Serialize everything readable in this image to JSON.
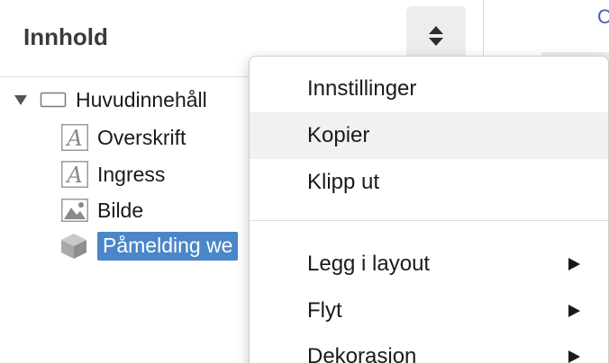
{
  "panel": {
    "title": "Innhold"
  },
  "tree": {
    "root": {
      "label": "Huvudinnehåll"
    },
    "children": [
      {
        "label": "Overskrift",
        "icon": "text-a-icon"
      },
      {
        "label": "Ingress",
        "icon": "text-a-icon"
      },
      {
        "label": "Bilde",
        "icon": "image-icon"
      },
      {
        "label": "Påmelding we",
        "icon": "cube-icon",
        "selected": true
      }
    ]
  },
  "context_menu": {
    "items": [
      {
        "label": "Innstillinger",
        "submenu": false
      },
      {
        "label": "Kopier",
        "submenu": false,
        "hovered": true
      },
      {
        "label": "Klipp ut",
        "submenu": false
      },
      {
        "label": "Legg i layout",
        "submenu": true
      },
      {
        "label": "Flyt",
        "submenu": true
      },
      {
        "label": "Dekorasjon",
        "submenu": true
      }
    ]
  },
  "background_fragment": {
    "text": "C"
  },
  "colors": {
    "selection": "#4a86c8",
    "accent_link": "#4a5bbd"
  }
}
